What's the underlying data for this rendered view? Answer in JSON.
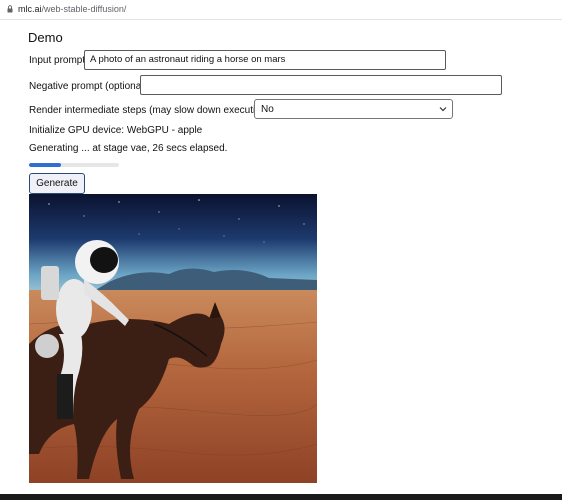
{
  "browser": {
    "url_host": "mlc.ai",
    "url_path": "/web-stable-diffusion/"
  },
  "demo": {
    "title": "Demo",
    "input_prompt_label": "Input prompt:",
    "input_prompt_value": "A photo of an astronaut riding a horse on mars",
    "negative_prompt_label": "Negative prompt (optional):",
    "negative_prompt_value": "",
    "render_steps_label": "Render intermediate steps (may slow down execution) -",
    "render_steps_selected": "No",
    "gpu_status": "Initialize GPU device: WebGPU - apple",
    "generation_status": "Generating ... at stage vae, 26 secs elapsed.",
    "progress_fraction": 0.35,
    "generate_button": "Generate"
  },
  "colors": {
    "progress": "#2f6fd1",
    "sky_top": "#0b1230",
    "desert": "#b5673e"
  }
}
